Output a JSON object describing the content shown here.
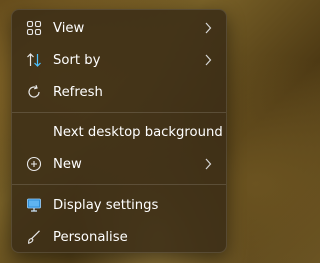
{
  "context_menu": {
    "items": [
      {
        "label": "View",
        "icon": "grid-icon",
        "submenu": true
      },
      {
        "label": "Sort by",
        "icon": "sort-icon",
        "submenu": true
      },
      {
        "label": "Refresh",
        "icon": "refresh-icon",
        "submenu": false
      },
      {
        "label": "Next desktop background",
        "icon": "",
        "submenu": false
      },
      {
        "label": "New",
        "icon": "plus-circle-icon",
        "submenu": true
      },
      {
        "label": "Display settings",
        "icon": "display-icon",
        "submenu": false
      },
      {
        "label": "Personalise",
        "icon": "brush-icon",
        "submenu": false
      }
    ]
  },
  "colors": {
    "menu_background": "#3a2c16",
    "text": "#ffffff",
    "accent": "#4cc2ff"
  }
}
